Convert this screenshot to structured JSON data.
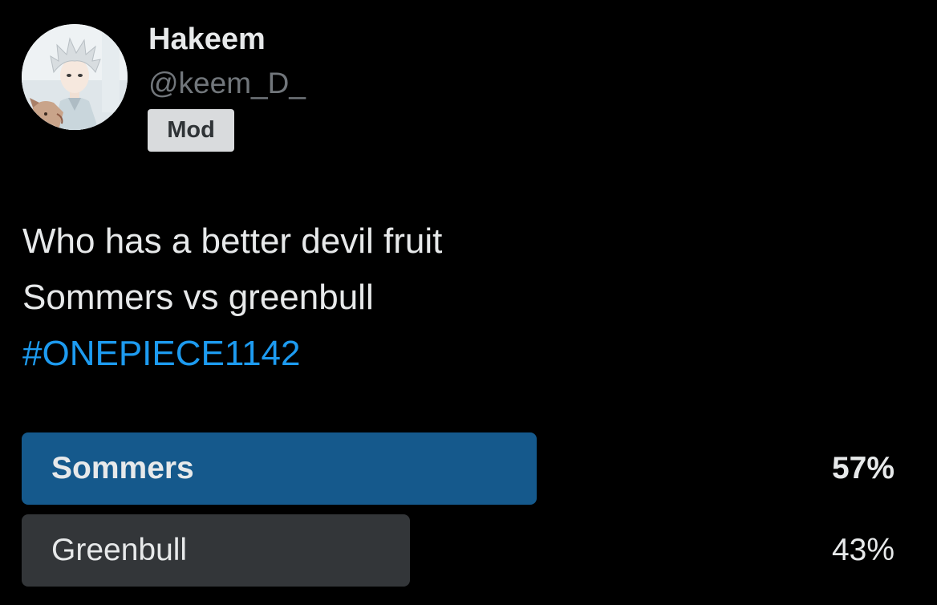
{
  "author": {
    "name": "Hakeem",
    "handle": "@keem_D_",
    "badge": "Mod",
    "avatar_icon": "anime-avatar-icon"
  },
  "tweet": {
    "lines": [
      "Who has a better devil fruit",
      "Sommers vs greenbull"
    ],
    "hashtag": "#ONEPIECE1142"
  },
  "poll": {
    "options": [
      {
        "label": "Sommers",
        "percent_text": "57%",
        "percent": 57,
        "winner": true,
        "bar_color": "#15598c"
      },
      {
        "label": "Greenbull",
        "percent_text": "43%",
        "percent": 43,
        "winner": false,
        "bar_color": "#333639"
      }
    ]
  },
  "colors": {
    "background": "#000000",
    "text": "#e7e9ea",
    "secondary_text": "#71767b",
    "hashtag": "#1d9bf0"
  }
}
